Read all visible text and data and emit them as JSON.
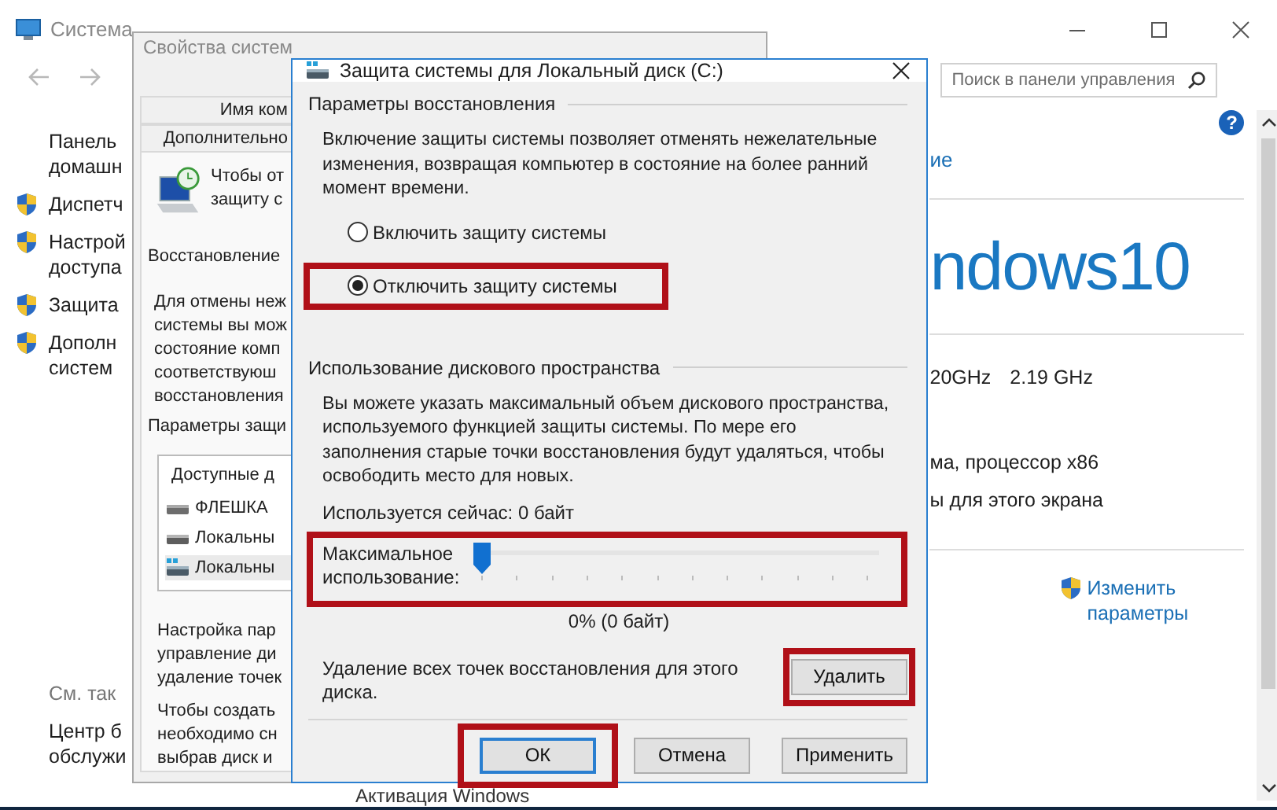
{
  "system_window": {
    "title": "Система",
    "search": {
      "placeholder": "Поиск в панели управления"
    },
    "sidebar": [
      {
        "kind": "plain",
        "lines": [
          "Панель",
          "домашн"
        ]
      },
      {
        "kind": "shield",
        "lines": [
          "Диспетч"
        ]
      },
      {
        "kind": "shield",
        "lines": [
          "Настрой",
          "доступа"
        ]
      },
      {
        "kind": "shield",
        "lines": [
          "Защита"
        ]
      },
      {
        "kind": "shield",
        "lines": [
          "Дополн",
          "систем"
        ]
      }
    ],
    "see_also": {
      "heading": "См. так",
      "links": [
        {
          "lines": [
            "Центр б",
            "обслужи"
          ]
        }
      ]
    },
    "help_glyph": "?",
    "info": {
      "partial_link": "ие",
      "logo": "ndows10",
      "cpu": [
        "20GHz",
        "2.19 GHz"
      ],
      "system_type": "ма, процессор x86",
      "pen": "ы для этого экрана",
      "change_link": [
        "Изменить",
        "параметры"
      ]
    },
    "activation": "Активация Windows"
  },
  "properties_window": {
    "title": "Свойства систем",
    "tabs": [
      {
        "label": "Имя ком",
        "selected": false
      },
      {
        "label": "Дополнительно",
        "selected": false
      }
    ],
    "intro_lines": [
      "Чтобы от",
      "защиту с"
    ],
    "restore_label": "Восстановление",
    "restore_lines": [
      "Для отмены неж",
      "системы вы мож",
      "состояние комп",
      "соответствуюш",
      "восстановления"
    ],
    "params_label": "Параметры защи",
    "drives": {
      "header": "Доступные д",
      "items": [
        {
          "kind": "usb",
          "label": "ФЛЕШКА",
          "selected": false
        },
        {
          "kind": "disk",
          "label": "Локальны",
          "selected": false
        },
        {
          "kind": "system",
          "label": "Локальны",
          "selected": true
        }
      ]
    },
    "config_lines": [
      "Настройка пар",
      "управление ди",
      "удаление точек"
    ],
    "create_lines": [
      "Чтобы создать",
      "необходимо сн",
      "выбрав диск и"
    ]
  },
  "dialog": {
    "title": "Защита системы для Локальный диск (C:)",
    "restore_section": {
      "heading": "Параметры восстановления",
      "description": "Включение защиты системы позволяет отменять нежелательные изменения, возвращая компьютер в состояние на более ранний момент времени.",
      "options": [
        {
          "label": "Включить защиту системы",
          "selected": false,
          "highlighted": false
        },
        {
          "label": "Отключить защиту системы",
          "selected": true,
          "highlighted": true
        }
      ]
    },
    "disk_section": {
      "heading": "Использование дискового пространства",
      "description": "Вы можете указать максимальный объем дискового пространства, используемого функцией защиты системы. По мере его заполнения старые точки восстановления будут удаляться, чтобы освободить место для новых.",
      "usage": "Используется сейчас:  0 байт",
      "max_label": "Максимальное использование:",
      "slider_highlighted": true,
      "level": 0,
      "reading": "0% (0 байт)",
      "delete_text": "Удаление всех точек восстановления для этого диска.",
      "delete_button": "Удалить",
      "delete_highlighted": true
    },
    "buttons": [
      {
        "label": "ОК",
        "default": true,
        "highlighted": true
      },
      {
        "label": "Отмена",
        "default": false,
        "highlighted": false
      },
      {
        "label": "Применить",
        "default": false,
        "highlighted": false
      }
    ]
  }
}
